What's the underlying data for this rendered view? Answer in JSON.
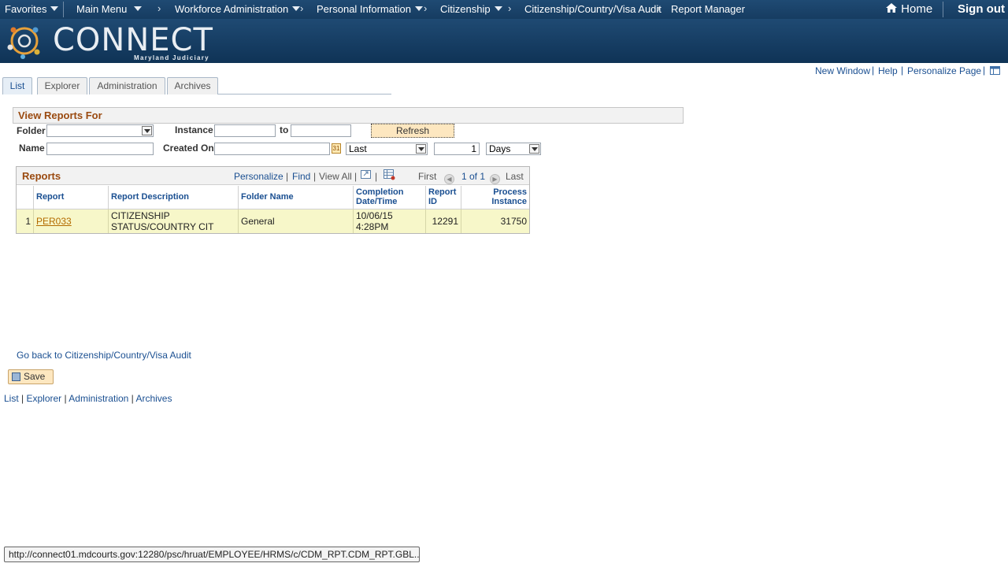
{
  "topnav": {
    "favorites": "Favorites",
    "main_menu": "Main Menu",
    "crumbs": [
      "Workforce Administration",
      "Personal Information",
      "Citizenship",
      "Citizenship/Country/Visa Audit",
      "Report Manager"
    ],
    "home": "Home",
    "sign_out": "Sign out"
  },
  "banner": {
    "logo": "CONNECT",
    "sub": "Maryland Judiciary"
  },
  "util": {
    "new_window": "New Window",
    "help": "Help",
    "personalize": "Personalize Page"
  },
  "tabs": [
    "List",
    "Explorer",
    "Administration",
    "Archives"
  ],
  "filter": {
    "title": "View Reports For",
    "folder_label": "Folder",
    "folder_value": "",
    "instance_label": "Instance",
    "instance_from": "",
    "to_label": "to",
    "instance_to": "",
    "refresh": "Refresh",
    "name_label": "Name",
    "name_value": "",
    "created_label": "Created On",
    "created_value": "",
    "last_value": "Last",
    "count_value": "1",
    "unit_value": "Days"
  },
  "grid": {
    "title": "Reports",
    "personalize": "Personalize",
    "find": "Find",
    "view_all": "View All",
    "first": "First",
    "range": "1 of 1",
    "last": "Last",
    "columns": [
      "Report",
      "Report Description",
      "Folder Name",
      "Completion Date/Time",
      "Report ID",
      "Process Instance"
    ],
    "rows": [
      {
        "num": "1",
        "report": "PER033",
        "desc": "CITIZENSHIP STATUS/COUNTRY CIT",
        "folder": "General",
        "completion": "10/06/15 4:28PM",
        "report_id": "12291",
        "process_instance": "31750"
      }
    ]
  },
  "go_back": "Go back to Citizenship/Country/Visa Audit",
  "save": "Save",
  "bottom_links": [
    "List",
    "Explorer",
    "Administration",
    "Archives"
  ],
  "status_url": "http://connect01.mdcourts.gov:12280/psc/hruat/EMPLOYEE/HRMS/c/CDM_RPT.CDM_RPT.GBL...",
  "colors": {
    "nav": "#1f4a73",
    "link": "#1a4f91",
    "section_title": "#9a4a10",
    "row": "#f7f7c9"
  }
}
